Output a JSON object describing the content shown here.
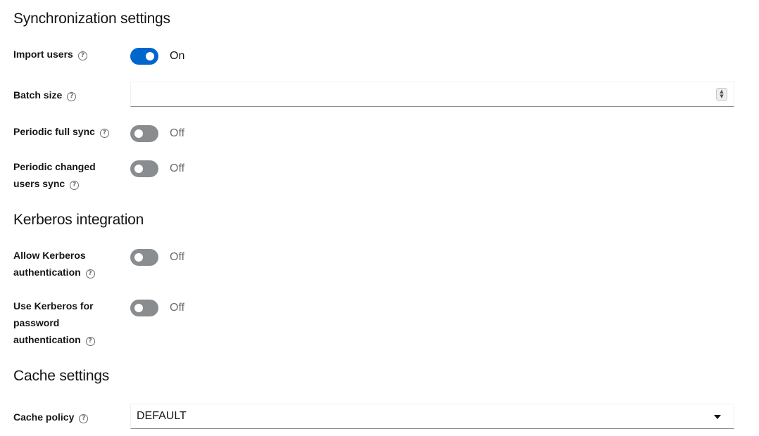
{
  "sections": {
    "sync": {
      "title": "Synchronization settings",
      "import_users": {
        "label": "Import users",
        "state": "On"
      },
      "batch_size": {
        "label": "Batch size",
        "value": ""
      },
      "periodic_full_sync": {
        "label": "Periodic full sync",
        "state": "Off"
      },
      "periodic_changed": {
        "label_line1": "Periodic changed",
        "label_line2": "users sync",
        "state": "Off"
      }
    },
    "kerberos": {
      "title": "Kerberos integration",
      "allow_auth": {
        "label_line1": "Allow Kerberos",
        "label_line2": "authentication",
        "state": "Off"
      },
      "use_for_password": {
        "label_line1": "Use Kerberos for",
        "label_line2": "password",
        "label_line3": "authentication",
        "state": "Off"
      }
    },
    "cache": {
      "title": "Cache settings",
      "cache_policy": {
        "label": "Cache policy",
        "value": "DEFAULT"
      }
    }
  },
  "icons": {
    "help": "question-circle-icon",
    "spinner": "number-spinner-icon",
    "caret": "caret-down-icon"
  },
  "colors": {
    "switch_on": "#0066cc",
    "switch_off": "#8a8d90",
    "text_off": "#6a6e73"
  }
}
